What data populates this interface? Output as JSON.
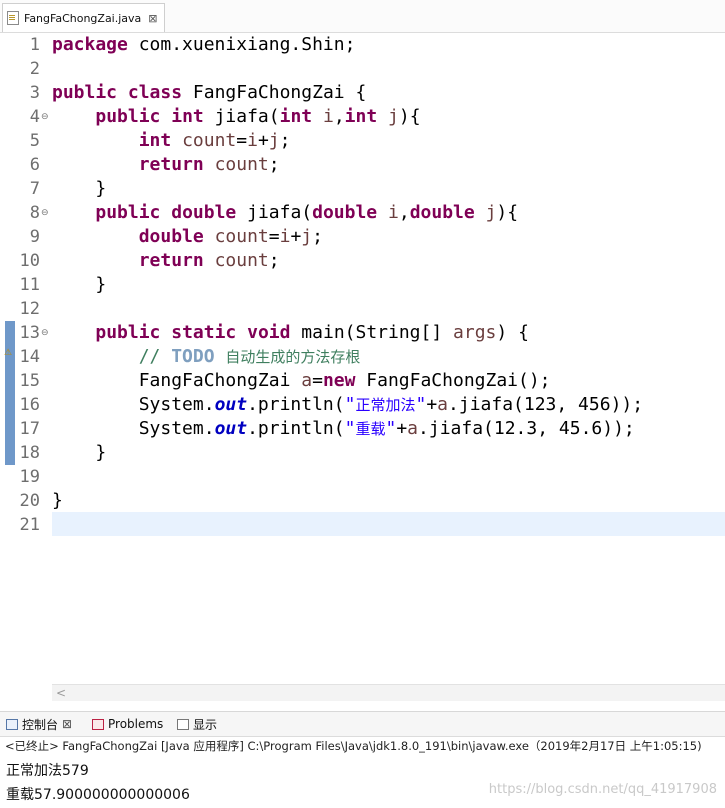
{
  "editor_tab": {
    "label": "FangFaChongZai.java",
    "close": "⊠"
  },
  "code_lines": [
    {
      "n": "1",
      "fold": "",
      "html": "<span class=\"kw\">package</span> com.xuenixiang.Shin;"
    },
    {
      "n": "2",
      "fold": "",
      "html": ""
    },
    {
      "n": "3",
      "fold": "",
      "html": "<span class=\"kw\">public</span> <span class=\"kw\">class</span> FangFaChongZai {"
    },
    {
      "n": "4",
      "fold": "⊖",
      "html": "    <span class=\"kw\">public</span> <span class=\"kw\">int</span> jiafa(<span class=\"kw\">int</span> <span class=\"var\">i</span>,<span class=\"kw\">int</span> <span class=\"var\">j</span>){"
    },
    {
      "n": "5",
      "fold": "",
      "html": "        <span class=\"kw\">int</span> <span class=\"var\">count</span>=<span class=\"var\">i</span>+<span class=\"var\">j</span>;"
    },
    {
      "n": "6",
      "fold": "",
      "html": "        <span class=\"kw\">return</span> <span class=\"var\">count</span>;"
    },
    {
      "n": "7",
      "fold": "",
      "html": "    }"
    },
    {
      "n": "8",
      "fold": "⊖",
      "html": "    <span class=\"kw\">public</span> <span class=\"kw\">double</span> jiafa(<span class=\"kw\">double</span> <span class=\"var\">i</span>,<span class=\"kw\">double</span> <span class=\"var\">j</span>){"
    },
    {
      "n": "9",
      "fold": "",
      "html": "        <span class=\"kw\">double</span> <span class=\"var\">count</span>=<span class=\"var\">i</span>+<span class=\"var\">j</span>;"
    },
    {
      "n": "10",
      "fold": "",
      "html": "        <span class=\"kw\">return</span> <span class=\"var\">count</span>;"
    },
    {
      "n": "11",
      "fold": "",
      "html": "    }"
    },
    {
      "n": "12",
      "fold": "",
      "html": ""
    },
    {
      "n": "13",
      "fold": "⊖",
      "html": "    <span class=\"kw\">public</span> <span class=\"kw\">static</span> <span class=\"kw\">void</span> main(String[] <span class=\"var\">args</span>) {"
    },
    {
      "n": "14",
      "fold": "",
      "html": "        <span class=\"cmt\">// <span class=\"todo\">TODO</span> <span class=\"cjk\">自动生成的方法存根</span></span>"
    },
    {
      "n": "15",
      "fold": "",
      "html": "        FangFaChongZai <span class=\"var\">a</span>=<span class=\"kw\">new</span> FangFaChongZai();"
    },
    {
      "n": "16",
      "fold": "",
      "html": "        System.<span class=\"fld\">out</span>.println(<span class=\"str\">\"<span class=\"cjk\">正常加法</span>\"</span>+<span class=\"var\">a</span>.jiafa(123, 456));"
    },
    {
      "n": "17",
      "fold": "",
      "html": "        System.<span class=\"fld\">out</span>.println(<span class=\"str\">\"<span class=\"cjk\">重载</span>\"</span>+<span class=\"var\">a</span>.jiafa(12.3, 45.6));"
    },
    {
      "n": "18",
      "fold": "",
      "html": "    }"
    },
    {
      "n": "19",
      "fold": "",
      "html": ""
    },
    {
      "n": "20",
      "fold": "",
      "html": "}"
    },
    {
      "n": "21",
      "fold": "",
      "html": ""
    }
  ],
  "scroll_left": "<",
  "warning_marker": "⚠",
  "console_tabs": [
    {
      "label": "控制台",
      "icon": "console-icon",
      "close": "⊠"
    },
    {
      "label": "Problems",
      "icon": "problems-icon"
    },
    {
      "label": "显示",
      "icon": "display-icon"
    }
  ],
  "console_header": "<已终止> FangFaChongZai [Java 应用程序] C:\\Program Files\\Java\\jdk1.8.0_191\\bin\\javaw.exe（2019年2月17日 上午1:05:15)",
  "console_output": [
    "正常加法579",
    "重载57.900000000000006"
  ],
  "watermark": "https://blog.csdn.net/qq_41917908"
}
